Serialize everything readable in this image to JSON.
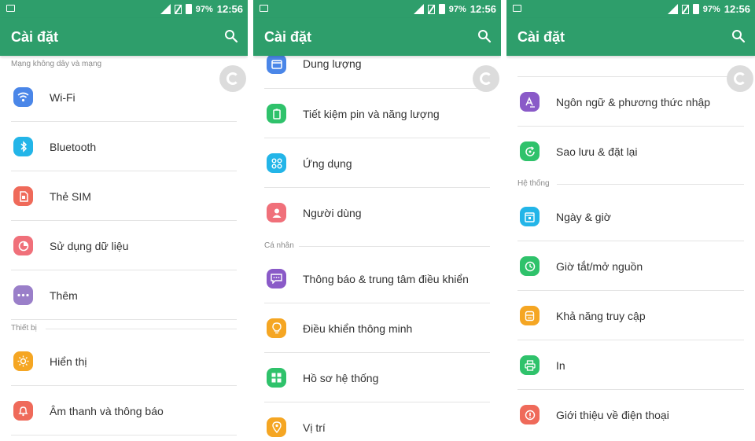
{
  "status": {
    "battery": "97%",
    "time": "12:56"
  },
  "appbar": {
    "title": "Cài đặt"
  },
  "colors": {
    "green": "#2e9e6b",
    "blue": "#4a86e8",
    "cyan": "#23b5e8",
    "red": "#ef6a5a",
    "pink": "#f0707a",
    "purple": "#9a7fc9",
    "orange": "#f5a623",
    "violet": "#8a5ac8"
  },
  "p1": {
    "sec_wireless": "Mạng không dây và mạng",
    "wifi": "Wi-Fi",
    "bluetooth": "Bluetooth",
    "sim": "Thẻ SIM",
    "data": "Sử dụng dữ liệu",
    "more": "Thêm",
    "sec_device": "Thiết bị",
    "display": "Hiển thị",
    "sound": "Âm thanh và thông báo"
  },
  "p2": {
    "storage": "Dung lượng",
    "battery": "Tiết kiệm pin và năng lượng",
    "apps": "Ứng dụng",
    "users": "Người dùng",
    "sec_personal": "Cá nhân",
    "notify": "Thông báo & trung tâm điều khiển",
    "smart": "Điều khiển thông minh",
    "profile": "Hồ sơ hệ thống",
    "location": "Vị trí"
  },
  "p3": {
    "language": "Ngôn ngữ & phương thức nhập",
    "backup": "Sao lưu & đặt lại",
    "sec_system": "Hệ thống",
    "datetime": "Ngày & giờ",
    "power": "Giờ tắt/mở nguồn",
    "access": "Khả năng truy cập",
    "print": "In",
    "about": "Giới thiệu về điện thoại"
  }
}
